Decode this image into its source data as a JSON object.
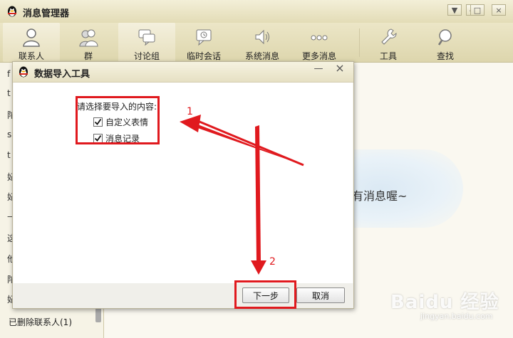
{
  "main_window": {
    "title": "消息管理器",
    "controls": {
      "menu": "▼",
      "minimize": "—",
      "maximize": "□",
      "close": "×"
    }
  },
  "toolbar": {
    "items": [
      {
        "label": "联系人",
        "icon": "person-icon"
      },
      {
        "label": "群",
        "icon": "group-icon"
      },
      {
        "label": "讨论组",
        "icon": "discussion-icon"
      },
      {
        "label": "临时会话",
        "icon": "temp-chat-icon"
      },
      {
        "label": "系统消息",
        "icon": "speaker-icon"
      },
      {
        "label": "更多消息",
        "icon": "more-dots-icon"
      },
      {
        "label": "工具",
        "icon": "wrench-icon"
      },
      {
        "label": "查找",
        "icon": "search-icon"
      }
    ]
  },
  "left_list": {
    "stubs": [
      "f",
      "t",
      "陀",
      "s",
      "t",
      "妃",
      "妃",
      "—",
      "这",
      "他",
      "陀",
      "妃"
    ],
    "bottom_item": "已删除联系人(1)"
  },
  "content": {
    "empty_text": "有消息喔~"
  },
  "dialog": {
    "title": "数据导入工具",
    "controls": {
      "minimize": "—",
      "close": "×"
    },
    "prompt": "请选择要导入的内容:",
    "options": [
      {
        "label": "自定义表情",
        "checked": true
      },
      {
        "label": "消息记录",
        "checked": true
      }
    ],
    "next_button": "下一步",
    "cancel_button": "取消"
  },
  "annotations": {
    "one": "1",
    "two": "2"
  },
  "watermark": {
    "logo": "Bai​du 经验",
    "url": "jingyan.baidu.com"
  },
  "colors": {
    "annotation_red": "#e0191e",
    "toolbar_bg": "#e3dcb6"
  }
}
